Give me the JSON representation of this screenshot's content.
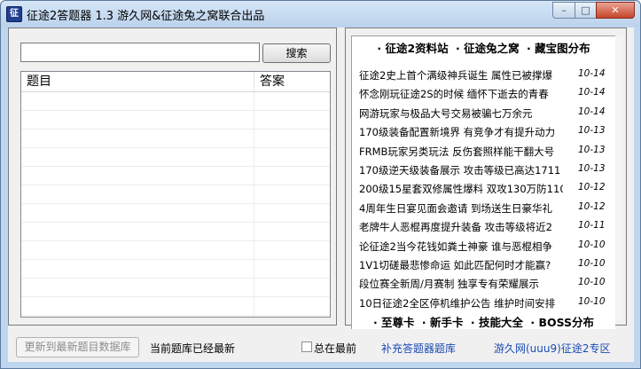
{
  "window": {
    "title": "征途2答题器 1.3  游久网&征途兔之窝联合出品",
    "app_icon": "app-icon",
    "minimize_label": "–",
    "maximize_label": "□",
    "close_label": "✕"
  },
  "search": {
    "value": "",
    "placeholder": "",
    "button_label": "搜索"
  },
  "table": {
    "columns": [
      "题目",
      "答案"
    ],
    "rows": []
  },
  "news": {
    "top_links": [
      "· 征途2资料站",
      "· 征途兔之窝",
      "· 藏宝图分布"
    ],
    "items": [
      {
        "title": "征途2史上首个满级神兵诞生 属性已被撑爆",
        "date": "10-14"
      },
      {
        "title": "怀念刚玩征途2S的时候 缅怀下逝去的青春",
        "date": "10-14"
      },
      {
        "title": "网游玩家与极品大号交易被骗七万余元",
        "date": "10-14"
      },
      {
        "title": "170级装备配置新境界 有竞争才有提升动力",
        "date": "10-13"
      },
      {
        "title": "FRMB玩家另类玩法 反伤套照样能干翻大号",
        "date": "10-13"
      },
      {
        "title": "170级逆天级装备展示 攻击等级已高达1711",
        "date": "10-13"
      },
      {
        "title": "200级15星套双修属性爆料 双攻130万防110",
        "date": "10-12"
      },
      {
        "title": "4周年生日宴见面会邀请 到场送生日豪华礼",
        "date": "10-12"
      },
      {
        "title": "老牌牛人恶棍再度提升装备 攻击等级将近2",
        "date": "10-11"
      },
      {
        "title": "论征途2当今花钱如粪土神豪 谁与恶棍相争",
        "date": "10-10"
      },
      {
        "title": "1V1切磋最悲惨命运 如此匹配何时才能赢?",
        "date": "10-10"
      },
      {
        "title": "段位赛全新周/月赛制 独享专有荣耀展示",
        "date": "10-10"
      },
      {
        "title": "10日征途2全区停机维护公告 维护时间安排",
        "date": "10-10"
      }
    ],
    "bottom_links": [
      "· 至尊卡",
      "· 新手卡",
      "· 技能大全",
      "· BOSS分布"
    ]
  },
  "footer": {
    "update_button": "更新到最新题目数据库",
    "status": "当前题库已经最新",
    "ontop_label": "总在最前",
    "ontop_checked": false,
    "add_link": "补充答题器题库",
    "zone_link": "游久网(uuu9)征途2专区"
  }
}
